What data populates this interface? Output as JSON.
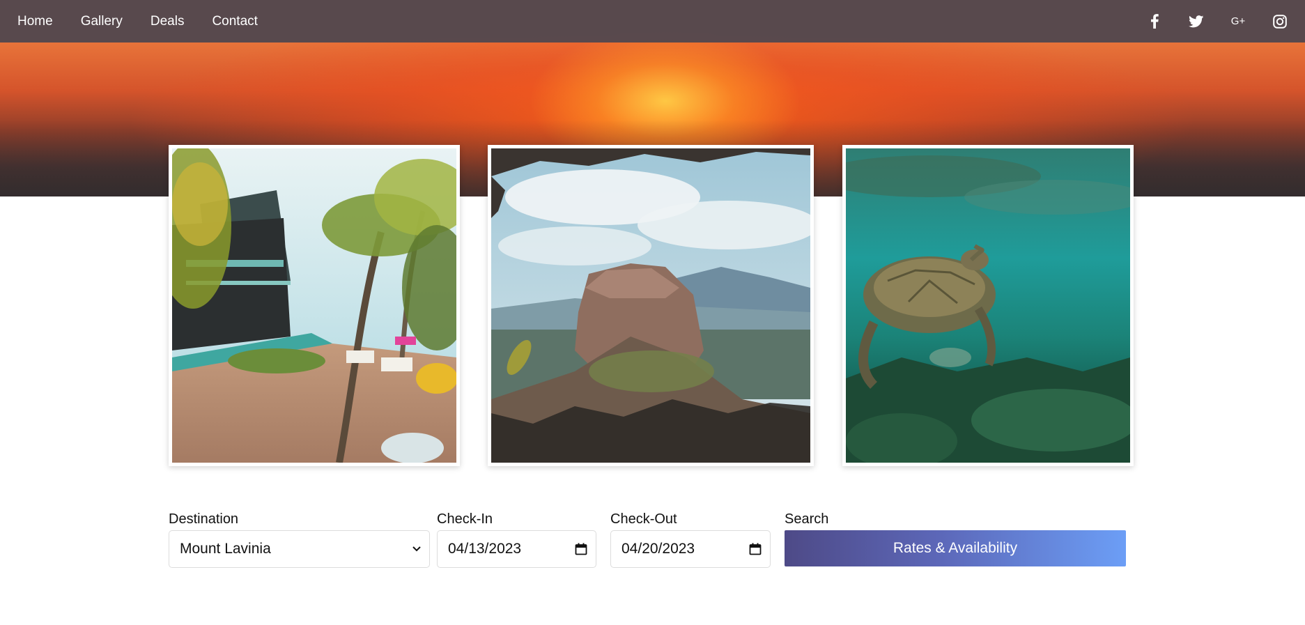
{
  "nav": {
    "links": [
      "Home",
      "Gallery",
      "Deals",
      "Contact"
    ]
  },
  "social": {
    "icons": [
      "facebook-icon",
      "twitter-icon",
      "google-plus-icon",
      "instagram-icon"
    ],
    "google_plus_text": "G+"
  },
  "gallery": {
    "items": [
      {
        "name": "resort-pool-photo"
      },
      {
        "name": "rock-fortress-photo"
      },
      {
        "name": "sea-turtle-photo"
      }
    ]
  },
  "booking": {
    "destination_label": "Destination",
    "destination_value": "Mount Lavinia",
    "checkin_label": "Check-In",
    "checkin_value": "04/13/2023",
    "checkout_label": "Check-Out",
    "checkout_value": "04/20/2023",
    "search_label": "Search",
    "search_button": "Rates & Availability"
  },
  "colors": {
    "navbar": "#52484e",
    "button_start": "#4e4a87",
    "button_end": "#6c9ef6"
  }
}
